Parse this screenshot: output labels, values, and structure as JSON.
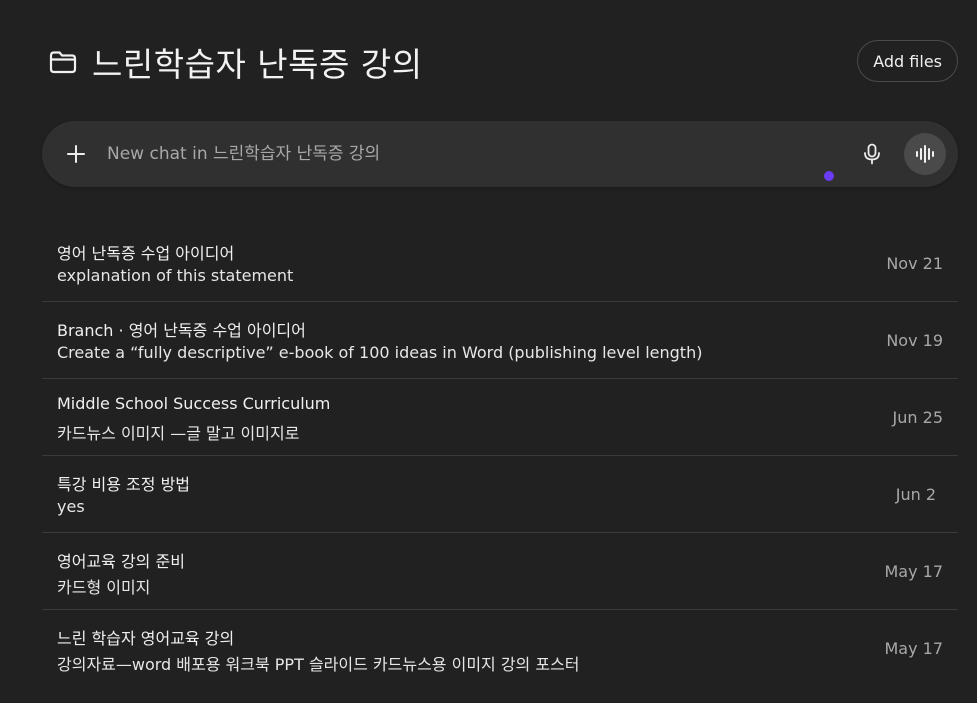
{
  "header": {
    "title": "느린학습자 난독증 강의",
    "add_files_label": "Add files"
  },
  "composer": {
    "placeholder": "New chat in 느린학습자 난독증 강의",
    "value": ""
  },
  "colors": {
    "background": "#212121",
    "composer": "#303030",
    "accent_dot": "#6a3cf5",
    "divider": "#3a3a3a"
  },
  "chats": [
    {
      "title": "영어 난독증 수업 아이디어",
      "snippet": "explanation of this statement",
      "date": "Nov 21"
    },
    {
      "title": "Branch · 영어 난독증 수업 아이디어",
      "snippet": "Create a “fully descriptive” e-book of 100 ideas in Word (publishing level length)",
      "date": "Nov 19"
    },
    {
      "title": "Middle School Success Curriculum",
      "snippet": "카드뉴스 이미지 —글 말고 이미지로",
      "date": "Jun 25"
    },
    {
      "title": "특강 비용 조정 방법",
      "snippet": "yes",
      "date": "Jun 2"
    },
    {
      "title": "영어교육 강의 준비",
      "snippet": "카드형 이미지",
      "date": "May 17"
    },
    {
      "title": "느린 학습자 영어교육 강의",
      "snippet": "강의자료—word 배포용 워크북 PPT 슬라이드 카드뉴스용 이미지 강의 포스터",
      "date": "May 17"
    }
  ],
  "icons": {
    "folder": "folder-icon",
    "plus": "plus-icon",
    "mic": "microphone-icon",
    "voice": "voice-waveform-icon"
  }
}
